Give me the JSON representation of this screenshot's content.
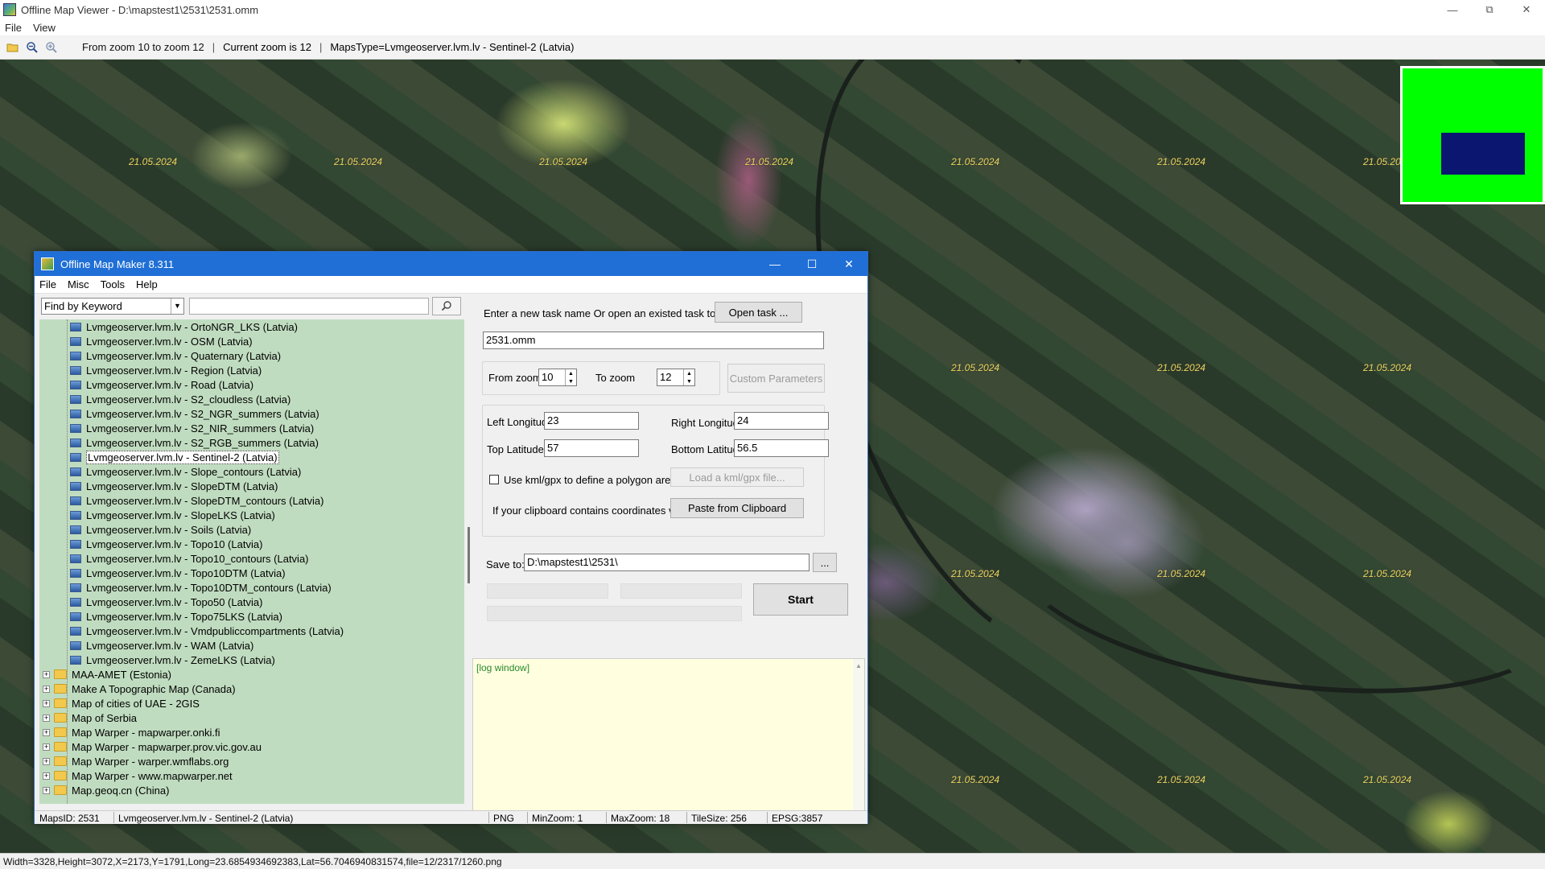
{
  "viewer": {
    "title": "Offline Map Viewer - D:\\mapstest1\\2531\\2531.omm",
    "menu": [
      "File",
      "View"
    ],
    "toolbar": {
      "zoom_range": "From zoom 10 to zoom 12",
      "current_zoom": "Current zoom is 12",
      "maps_type": "MapsType=Lvmgeoserver.lvm.lv - Sentinel-2 (Latvia)",
      "separator": "|"
    },
    "date_label": "21.05.2024",
    "status": "Width=3328,Height=3072,X=2173,Y=1791,Long=23.6854934692383,Lat=56.7046940831574,file=12/2317/1260.png"
  },
  "dialog": {
    "title": "Offline Map Maker 8.311",
    "menu": [
      "File",
      "Misc",
      "Tools",
      "Help"
    ],
    "search_mode": "Find by Keyword",
    "search_value": "",
    "tree_children": [
      "Lvmgeoserver.lvm.lv - OrtoNGR_LKS (Latvia)",
      "Lvmgeoserver.lvm.lv - OSM (Latvia)",
      "Lvmgeoserver.lvm.lv - Quaternary (Latvia)",
      "Lvmgeoserver.lvm.lv - Region (Latvia)",
      "Lvmgeoserver.lvm.lv - Road (Latvia)",
      "Lvmgeoserver.lvm.lv - S2_cloudless (Latvia)",
      "Lvmgeoserver.lvm.lv - S2_NGR_summers (Latvia)",
      "Lvmgeoserver.lvm.lv - S2_NIR_summers (Latvia)",
      "Lvmgeoserver.lvm.lv - S2_RGB_summers (Latvia)",
      "Lvmgeoserver.lvm.lv - Sentinel-2 (Latvia)",
      "Lvmgeoserver.lvm.lv - Slope_contours (Latvia)",
      "Lvmgeoserver.lvm.lv - SlopeDTM (Latvia)",
      "Lvmgeoserver.lvm.lv - SlopeDTM_contours (Latvia)",
      "Lvmgeoserver.lvm.lv - SlopeLKS (Latvia)",
      "Lvmgeoserver.lvm.lv - Soils (Latvia)",
      "Lvmgeoserver.lvm.lv - Topo10 (Latvia)",
      "Lvmgeoserver.lvm.lv - Topo10_contours (Latvia)",
      "Lvmgeoserver.lvm.lv - Topo10DTM (Latvia)",
      "Lvmgeoserver.lvm.lv - Topo10DTM_contours (Latvia)",
      "Lvmgeoserver.lvm.lv - Topo50 (Latvia)",
      "Lvmgeoserver.lvm.lv - Topo75LKS (Latvia)",
      "Lvmgeoserver.lvm.lv - Vmdpubliccompartments (Latvia)",
      "Lvmgeoserver.lvm.lv - WAM (Latvia)",
      "Lvmgeoserver.lvm.lv - ZemeLKS (Latvia)"
    ],
    "selected_child": "Lvmgeoserver.lvm.lv - Sentinel-2 (Latvia)",
    "tree_folders": [
      "MAA-AMET (Estonia)",
      "Make A Topographic Map (Canada)",
      "Map of cities of UAE - 2GIS",
      "Map of Serbia",
      "Map Warper - mapwarper.onki.fi",
      "Map Warper - mapwarper.prov.vic.gov.au",
      "Map Warper - warper.wmflabs.org",
      "Map Warper - www.mapwarper.net",
      "Map.geoq.cn (China)"
    ],
    "task_prompt": "Enter a new task name Or open an existed task to continue:",
    "open_task_label": "Open task ...",
    "task_name": "2531.omm",
    "from_zoom_label": "From zoom",
    "from_zoom": "10",
    "to_zoom_label": "To zoom",
    "to_zoom": "12",
    "custom_params_label": "Custom Parameters",
    "left_lon_label": "Left Longitude",
    "left_lon": "23",
    "right_lon_label": "Right Longitude",
    "right_lon": "24",
    "top_lat_label": "Top Latitude",
    "top_lat": "57",
    "bottom_lat_label": "Bottom Latitude",
    "bottom_lat": "56.5",
    "kml_label": "Use kml/gpx to define a polygon area",
    "kml_checked": false,
    "load_kml_label": "Load a kml/gpx file...",
    "clipboard_prompt": "If your clipboard contains coordinates values:",
    "paste_label": "Paste from Clipboard",
    "save_to_label": "Save to:",
    "save_to": "D:\\mapstest1\\2531\\",
    "browse_label": "...",
    "start_label": "Start",
    "log_text": "[log window]",
    "status": {
      "maps_id": "MapsID: 2531",
      "maps_name": "Lvmgeoserver.lvm.lv - Sentinel-2 (Latvia)",
      "format": "PNG",
      "min_zoom": "MinZoom: 1",
      "max_zoom": "MaxZoom: 18",
      "tile_size": "TileSize: 256",
      "epsg": "EPSG:3857"
    }
  },
  "colors": {
    "dialog_titlebar": "#1f6fd6",
    "tree_background": "#c0dcc0",
    "log_background": "#ffffe0",
    "minimap_background": "#00ff00",
    "minimap_viewport": "#0a1670",
    "date_label": "#e8d45a"
  }
}
